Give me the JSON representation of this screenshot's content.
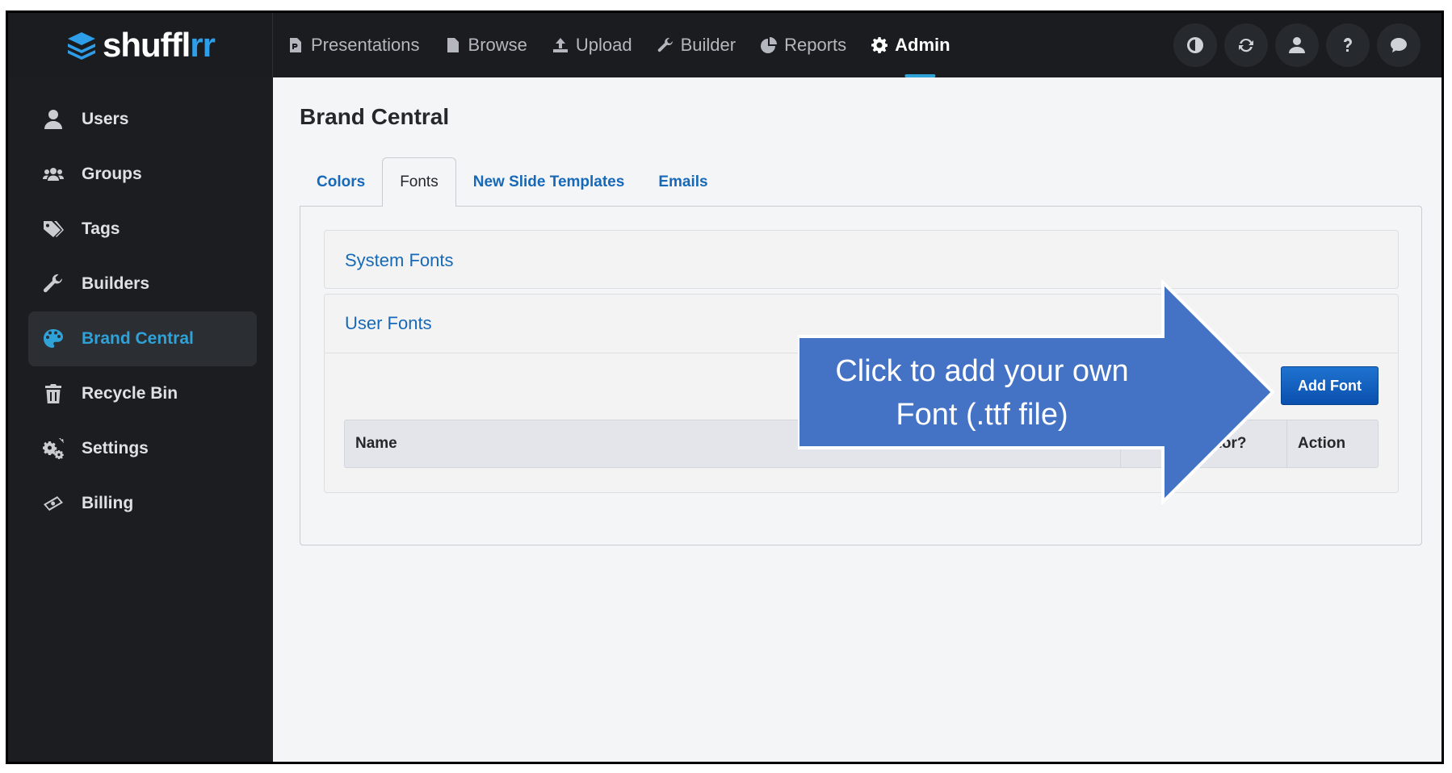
{
  "brand": {
    "name_main": "shuffl",
    "name_accent": "rr"
  },
  "nav": {
    "items": [
      {
        "label": "Presentations",
        "icon": "file-presentation-icon"
      },
      {
        "label": "Browse",
        "icon": "file-text-icon"
      },
      {
        "label": "Upload",
        "icon": "upload-icon"
      },
      {
        "label": "Builder",
        "icon": "wrench-icon"
      },
      {
        "label": "Reports",
        "icon": "pie-chart-icon"
      },
      {
        "label": "Admin",
        "icon": "gear-icon",
        "active": true
      }
    ],
    "right_icons": [
      "contrast-icon",
      "refresh-icon",
      "user-icon",
      "help-icon",
      "chat-icon"
    ]
  },
  "sidebar": {
    "items": [
      {
        "label": "Users",
        "icon": "user-icon"
      },
      {
        "label": "Groups",
        "icon": "users-icon"
      },
      {
        "label": "Tags",
        "icon": "tags-icon"
      },
      {
        "label": "Builders",
        "icon": "wrench-icon"
      },
      {
        "label": "Brand Central",
        "icon": "palette-icon",
        "active": true
      },
      {
        "label": "Recycle Bin",
        "icon": "trash-icon"
      },
      {
        "label": "Settings",
        "icon": "cogs-icon"
      },
      {
        "label": "Billing",
        "icon": "money-icon"
      }
    ]
  },
  "main": {
    "title": "Brand Central",
    "tabs": [
      {
        "label": "Colors"
      },
      {
        "label": "Fonts",
        "active": true
      },
      {
        "label": "New Slide Templates"
      },
      {
        "label": "Emails"
      }
    ],
    "system_fonts_label": "System Fonts",
    "user_fonts_label": "User Fonts",
    "add_font_label": "Add Font",
    "table_headers": {
      "name": "Name",
      "allow": "Allow in editor?",
      "action": "Action"
    }
  },
  "callout": {
    "line1": "Click to add your own",
    "line2": "Font (.ttf file)"
  },
  "colors": {
    "accent": "#2fa2d8",
    "link": "#1769b8",
    "callout": "#4472c4",
    "button": "#0d5bbf"
  }
}
